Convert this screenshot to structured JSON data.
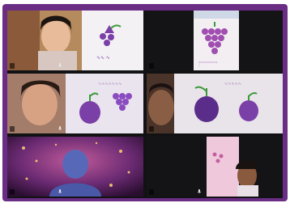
{
  "app": {
    "layout": "gallery-view"
  },
  "tiles": [
    {
      "name": "",
      "content": "girl-holding-grape-drawing"
    },
    {
      "name": "",
      "content": "grape-bunch-paper"
    },
    {
      "name": "",
      "content": "girl-with-purple-drawings"
    },
    {
      "name": "",
      "content": "boy-with-grape-paintings"
    },
    {
      "name": "",
      "content": "virtual-background-participant"
    },
    {
      "name": "",
      "content": "child-holding-pink-paper"
    }
  ],
  "colors": {
    "frame": "#6a2d84",
    "grid_bg": "#121214",
    "grape": "#7b3fa8",
    "leaf": "#3c9a3a"
  }
}
